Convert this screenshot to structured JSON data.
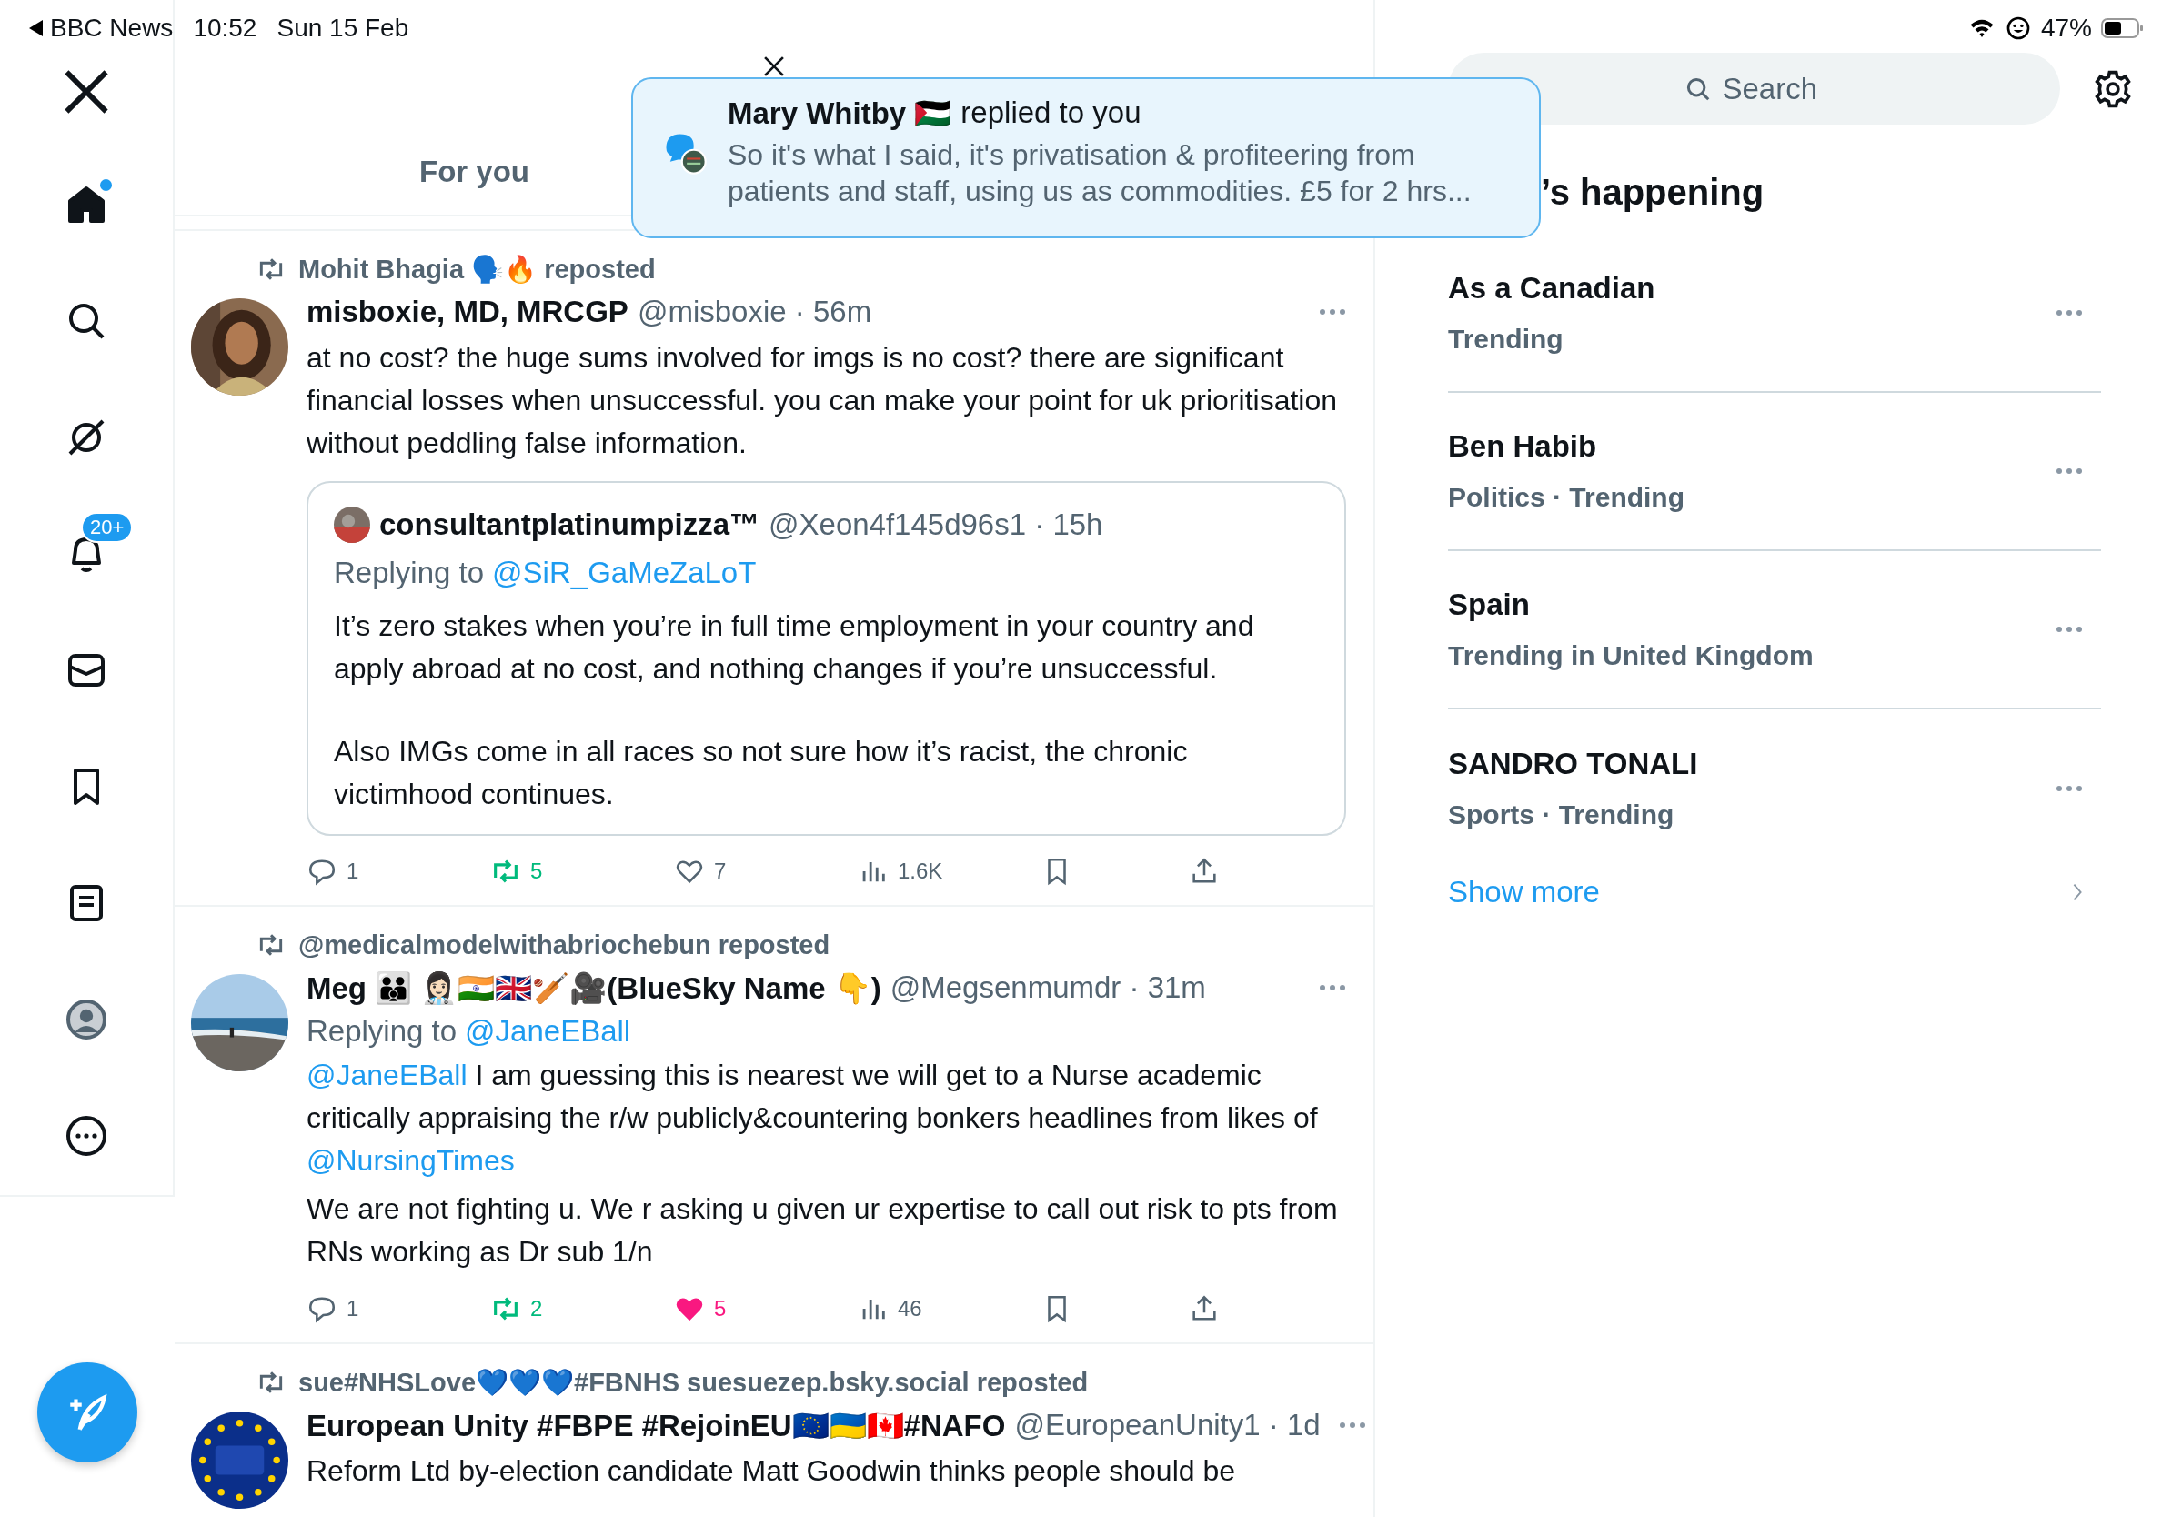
{
  "status_bar": {
    "back_app": "BBC News",
    "time": "10:52",
    "date": "Sun 15 Feb",
    "battery": "47%"
  },
  "sidebar": {
    "items": [
      {
        "kind": "home",
        "selected": true,
        "unread": true
      },
      {
        "kind": "search",
        "selected": false,
        "unread": false
      },
      {
        "kind": "grok",
        "selected": false,
        "unread": false
      },
      {
        "kind": "notifications",
        "selected": false,
        "unread": false,
        "badge": "20+"
      },
      {
        "kind": "messages",
        "selected": false,
        "unread": false
      },
      {
        "kind": "bookmarks",
        "selected": false,
        "unread": false
      },
      {
        "kind": "lists",
        "selected": false,
        "unread": false
      },
      {
        "kind": "profile",
        "selected": false,
        "unread": false
      },
      {
        "kind": "more",
        "selected": false,
        "unread": false
      }
    ]
  },
  "header": {
    "tabs": [
      {
        "label": "For you",
        "selected": false
      }
    ]
  },
  "toast": {
    "name": "Mary Whitby 🇵🇸",
    "action": "replied to you",
    "message": "So it's what I said, it's privatisation & profiteering from patients and staff, using us as commodities. £5 for 2 hrs..."
  },
  "posts": [
    {
      "reposted_by": "Mohit Bhagia 🗣️🔥 reposted",
      "name": "misboxie, MD, MRCGP",
      "meta": "@misboxie · 56m",
      "paragraphs": [
        [
          {
            "kind": "text",
            "text": "at no cost? the huge sums involved for imgs is no cost? there are significant financial losses when unsuccessful. you can make your point for uk prioritisation without peddling false information."
          }
        ]
      ],
      "quote": {
        "name": "consultantplatinumpizza™",
        "meta": "@Xeon4f145d96s1 · 15h",
        "replying_prefix": "Replying to",
        "replying_mention": "@SiR_GaMeZaLoT",
        "paragraphs": [
          "It’s zero stakes when you’re in full time employment in your country and apply abroad at no cost, and nothing changes if you’re unsuccessful.",
          "Also IMGs come in all races so not sure how it’s racist, the chronic victimhood continues."
        ]
      },
      "actions": {
        "replies": "1",
        "reposts": "5",
        "likes": "7",
        "views": "1.6K",
        "reposted": true,
        "liked": false
      }
    },
    {
      "reposted_by": "@medicalmodelwithabriochebun reposted",
      "name": "Meg 👪 👩🏻‍⚕️🇮🇳🇬🇧🏏🎥(BlueSky Name 👇)",
      "meta": "@Megsenmumdr · 31m",
      "replying_prefix": "Replying to",
      "replying_mention": "@JaneEBall",
      "paragraphs": [
        [
          {
            "kind": "mention",
            "text": "@JaneEBall"
          },
          {
            "kind": "text",
            "text": " I am guessing this is nearest we will get to a Nurse academic critically appraising the r/w publicly&countering bonkers headlines from likes of "
          },
          {
            "kind": "mention",
            "text": "@NursingTimes"
          }
        ],
        [
          {
            "kind": "text",
            "text": "We are not fighting u. We r asking u given ur expertise to call out risk to pts from RNs working as Dr sub 1/n"
          }
        ]
      ],
      "actions": {
        "replies": "1",
        "reposts": "2",
        "likes": "5",
        "views": "46",
        "reposted": true,
        "liked": true
      }
    },
    {
      "reposted_by": "sue#NHSLove💙💙💙#FBNHS suesuezep.bsky.social reposted",
      "name": "European Unity #FBPE #RejoinEU🇪🇺🇺🇦🇨🇦#NAFO",
      "meta": "@EuropeanUnity1 · 1d",
      "paragraphs": [
        [
          {
            "kind": "text",
            "text": "Reform Ltd by-election candidate Matt Goodwin thinks people should be"
          }
        ]
      ]
    }
  ],
  "right": {
    "search": {
      "placeholder": "Search"
    },
    "title": "’s happening",
    "trends": [
      {
        "name": "As a Canadian",
        "meta": "Trending"
      },
      {
        "name": "Ben Habib",
        "meta": "Politics · Trending"
      },
      {
        "name": "Spain",
        "meta": "Trending in United Kingdom"
      },
      {
        "name": "SANDRO TONALI",
        "meta": "Sports · Trending"
      }
    ],
    "show_more": "Show more"
  }
}
